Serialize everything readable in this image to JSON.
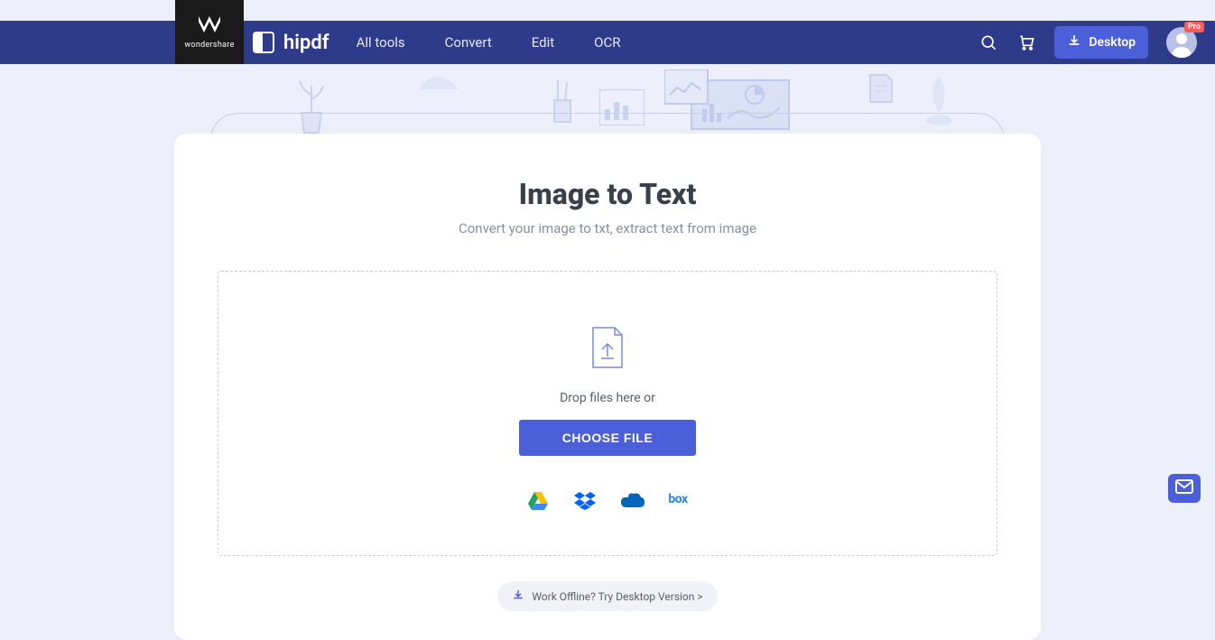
{
  "brand": {
    "parent": "wondershare",
    "name": "hipdf"
  },
  "nav": {
    "all_tools": "All tools",
    "convert": "Convert",
    "edit": "Edit",
    "ocr": "OCR",
    "desktop": "Desktop"
  },
  "avatar": {
    "badge": "Pro"
  },
  "main": {
    "title": "Image to Text",
    "subtitle": "Convert your image to txt, extract text from image",
    "drop_text": "Drop files here or",
    "choose_btn": "CHOOSE FILE"
  },
  "cloud": {
    "gdrive": "google-drive-icon",
    "dropbox": "dropbox-icon",
    "onedrive": "onedrive-icon",
    "box": "box"
  },
  "offline": {
    "text": "Work Offline? Try Desktop Version >"
  }
}
